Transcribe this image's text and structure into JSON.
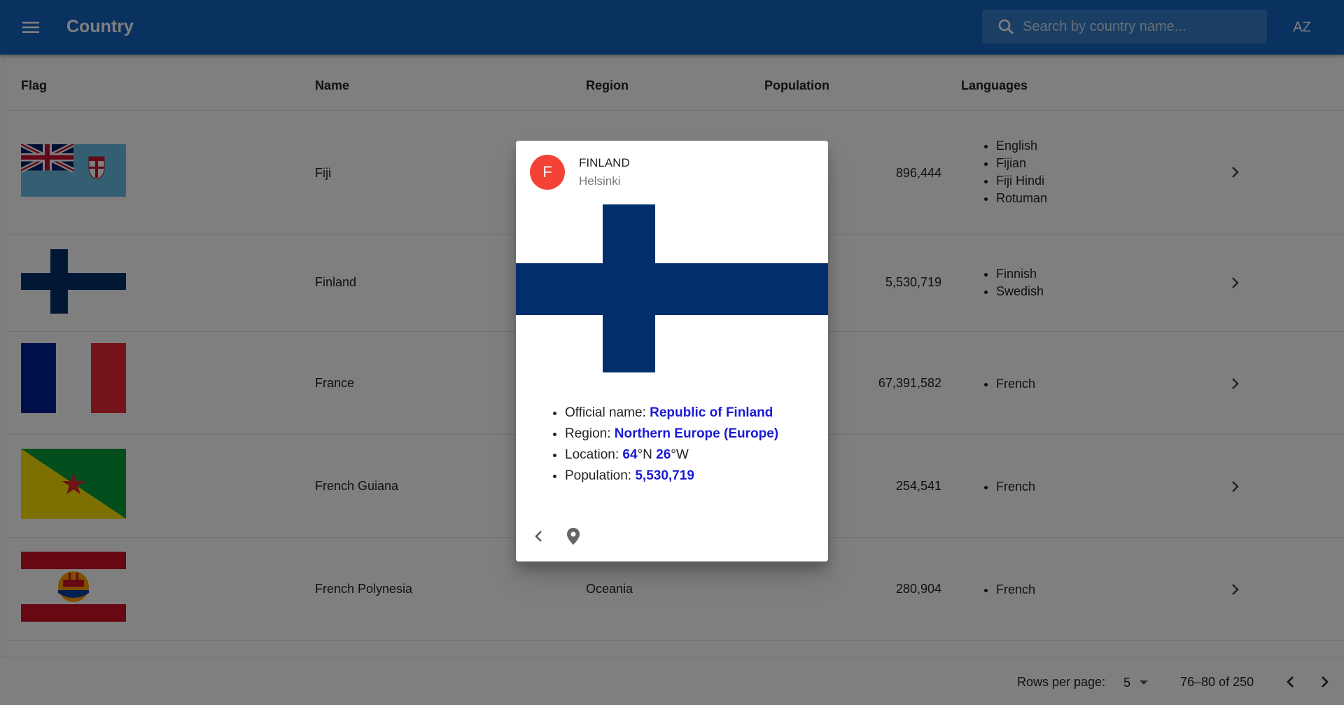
{
  "appbar": {
    "title": "Country",
    "search_placeholder": "Search by country name...",
    "sort_label": "AZ",
    "menu_icon": "menu-icon",
    "search_icon": "search-icon",
    "color": "#1565c0"
  },
  "table": {
    "headers": [
      "Flag",
      "Name",
      "Region",
      "Population",
      "Languages"
    ],
    "rows": [
      {
        "name": "Fiji",
        "region": "",
        "population": "896,444",
        "languages": [
          "English",
          "Fijian",
          "Fiji Hindi",
          "Rotuman"
        ]
      },
      {
        "name": "Finland",
        "region": "",
        "population": "5,530,719",
        "languages": [
          "Finnish",
          "Swedish"
        ]
      },
      {
        "name": "France",
        "region": "",
        "population": "67,391,582",
        "languages": [
          "French"
        ]
      },
      {
        "name": "French Guiana",
        "region": "",
        "population": "254,541",
        "languages": [
          "French"
        ]
      },
      {
        "name": "French Polynesia",
        "region": "Oceania",
        "population": "280,904",
        "languages": [
          "French"
        ]
      }
    ]
  },
  "footer": {
    "rows_per_page_label": "Rows per page:",
    "rows_per_page_value": "5",
    "range": "76–80 of 250"
  },
  "dialog": {
    "avatar_letter": "F",
    "avatar_color": "#f44336",
    "title": "FINLAND",
    "subtitle": "Helsinki",
    "official_name_label": "Official name: ",
    "official_name": "Republic of Finland",
    "region_label": "Region: ",
    "region": "Northern Europe (Europe)",
    "location_label": "Location: ",
    "lat": "64",
    "lat_suffix": "°N ",
    "lng": "26",
    "lng_suffix": "°W",
    "population_label": "Population: ",
    "population": "5,530,719",
    "value_color": "#1a1ad6"
  }
}
